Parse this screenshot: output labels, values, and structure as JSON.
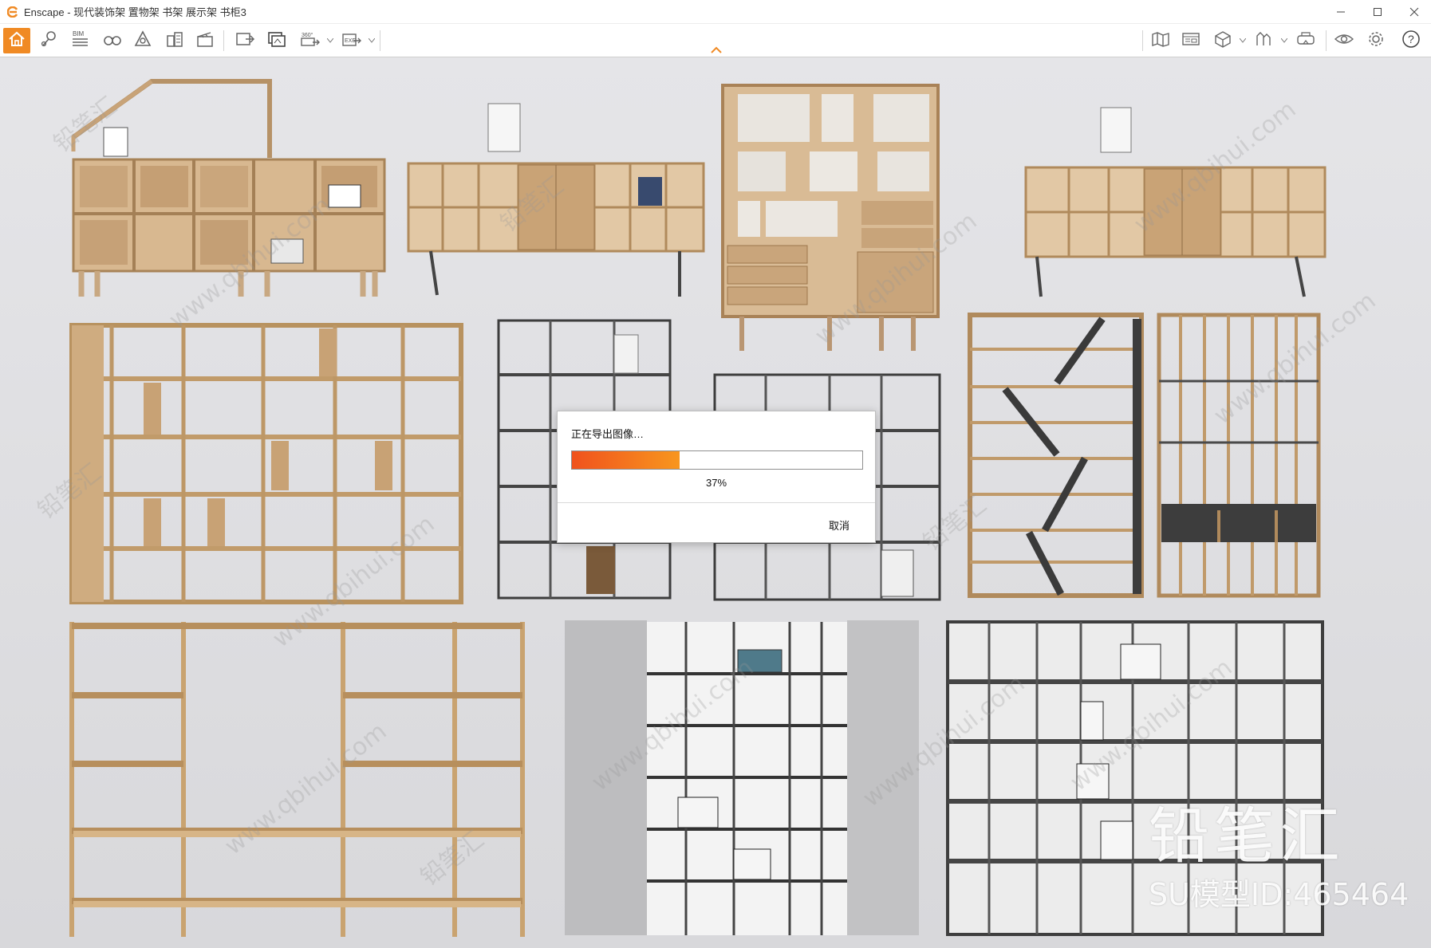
{
  "window": {
    "title": "Enscape - 现代装饰架 置物架 书架 展示架 书柜3"
  },
  "toolbar": {
    "bim_label": "BIM",
    "pano_label": "360°",
    "exe_label": "EXE",
    "accent_color": "#f08a24"
  },
  "dialog": {
    "title": "正在导出图像…",
    "progress": 0.37,
    "percent_text": "37%",
    "cancel_label": "取消"
  },
  "branding": {
    "brand_text": "铅笔汇",
    "model_id": "SU模型ID:465464"
  },
  "watermarks": {
    "site": "www.qbihui.com",
    "cn": "铅笔汇"
  },
  "icons": {
    "home": "home-icon",
    "location": "location-pin-icon",
    "bim": "bim-list-icon",
    "views": "binoculars-icon",
    "assets": "asset-library-icon",
    "buildings": "buildings-icon",
    "video": "video-editor-icon",
    "screenshot": "screenshot-icon",
    "batch_render": "batch-render-icon",
    "panorama": "panorama-icon",
    "exe_export": "exe-export-icon",
    "map": "map-icon",
    "web_standalone": "web-standalone-icon",
    "cube": "cube-icon",
    "material": "material-editor-icon",
    "vr": "vr-headset-icon",
    "visual": "visual-settings-icon",
    "settings": "gear-icon",
    "help": "help-icon"
  }
}
